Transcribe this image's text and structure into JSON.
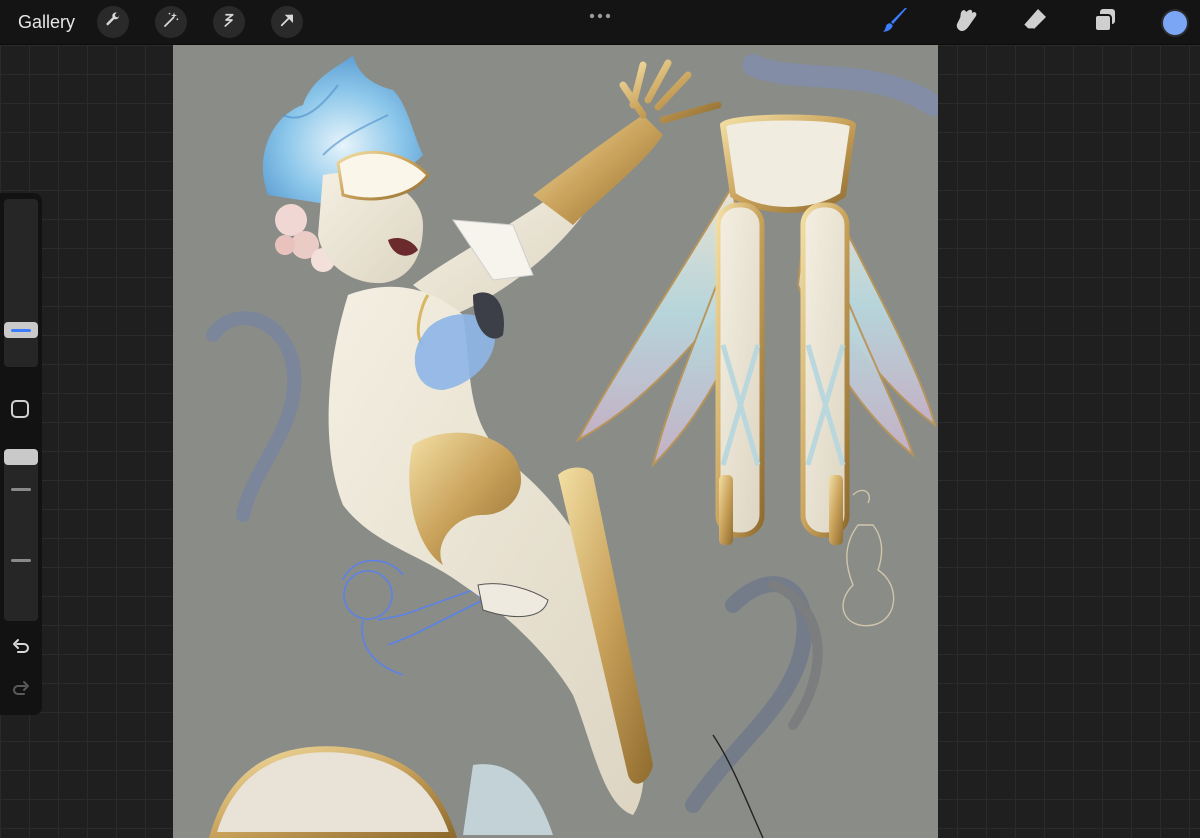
{
  "toolbar": {
    "gallery_label": "Gallery",
    "left_tools": [
      "wrench-icon",
      "magic-wand-icon",
      "selection-icon",
      "transform-arrow-icon"
    ],
    "right_tools": [
      "brush-icon",
      "smudge-icon",
      "eraser-icon",
      "layers-icon"
    ],
    "active_tool": "brush-icon",
    "active_color": "#7aa6f5"
  },
  "sidebar": {
    "brush_size_level": 0.19,
    "brush_opacity_level": 0.0,
    "accent_color": "#3d7dff"
  },
  "canvas": {
    "background_color": "#8a8c87"
  }
}
